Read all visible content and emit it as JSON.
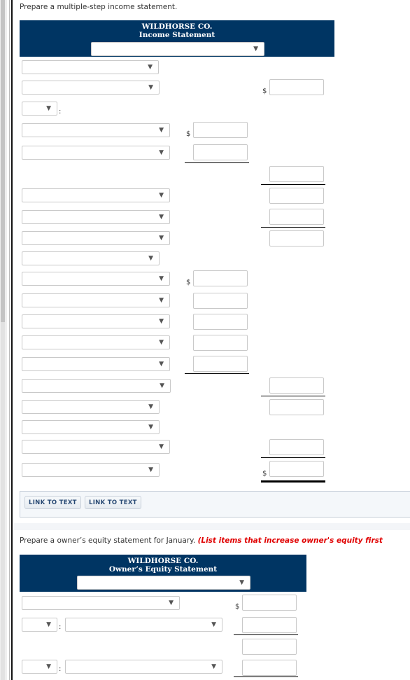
{
  "income_section": {
    "instruction": "Prepare a multiple-step income statement.",
    "company": "WILDHORSE CO.",
    "statement_title": "Income Statement",
    "period_select": {
      "value": ""
    },
    "rows": [
      {
        "type": "select",
        "value": ""
      },
      {
        "type": "select",
        "value": "",
        "amount_col": "right",
        "currency": "$"
      },
      {
        "type": "short-select",
        "value": "",
        "suffix": ":"
      },
      {
        "type": "select",
        "value": "",
        "amount_col": "middle",
        "currency": "$"
      },
      {
        "type": "select",
        "value": "",
        "amount_col": "middle"
      },
      {
        "type": "amount-only",
        "amount_col": "right"
      },
      {
        "type": "select",
        "value": "",
        "amount_col": "right"
      },
      {
        "type": "select",
        "value": "",
        "amount_col": "right"
      },
      {
        "type": "select",
        "value": "",
        "amount_col": "right"
      },
      {
        "type": "select",
        "value": ""
      },
      {
        "type": "select",
        "value": "",
        "amount_col": "middle",
        "currency": "$"
      },
      {
        "type": "select",
        "value": "",
        "amount_col": "middle"
      },
      {
        "type": "select",
        "value": "",
        "amount_col": "middle"
      },
      {
        "type": "select",
        "value": "",
        "amount_col": "middle"
      },
      {
        "type": "select",
        "value": "",
        "amount_col": "middle"
      },
      {
        "type": "select",
        "value": "",
        "amount_col": "right"
      },
      {
        "type": "select",
        "value": "",
        "amount_col": "right"
      },
      {
        "type": "select",
        "value": ""
      },
      {
        "type": "select",
        "value": "",
        "amount_col": "right"
      },
      {
        "type": "select",
        "value": "",
        "amount_col": "right",
        "currency": "$"
      }
    ],
    "currency_symbol": "$",
    "colon": ":",
    "link_buttons": [
      "LINK TO TEXT",
      "LINK TO TEXT"
    ]
  },
  "equity_section": {
    "instruction": "Prepare a owner’s equity statement for January.",
    "instruction_note": "(List items that increase owner's equity first",
    "company": "WILDHORSE CO.",
    "statement_title": "Owner’s Equity Statement",
    "period_select": {
      "value": ""
    },
    "currency_symbol": "$",
    "colon": ":"
  },
  "icons": {
    "dropdown_arrow": "▼"
  },
  "colors": {
    "header_bg": "#003563",
    "note_red": "#e00000",
    "link_text": "#2a4b75"
  }
}
